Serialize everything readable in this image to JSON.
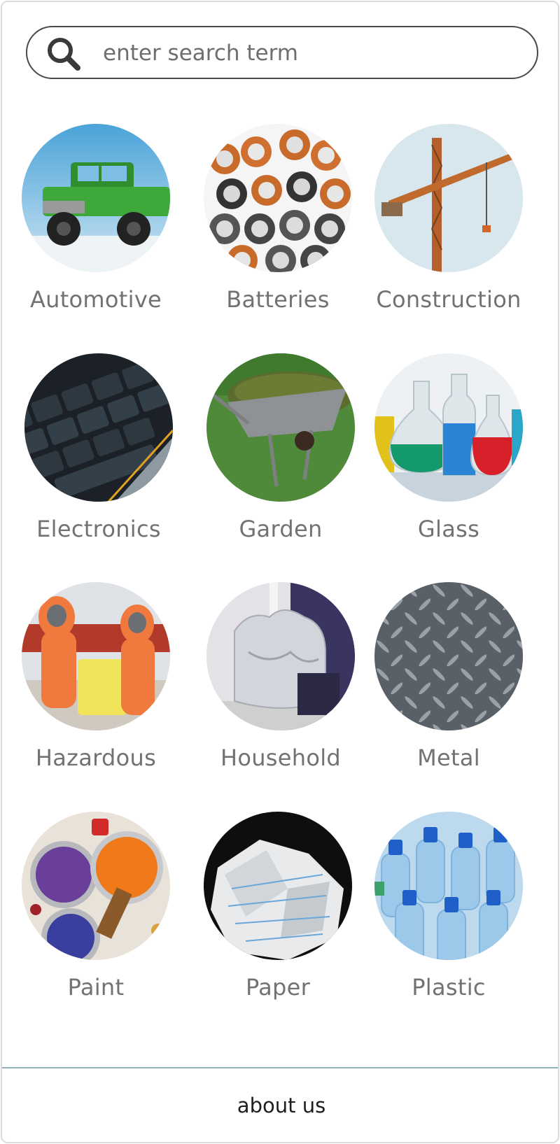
{
  "search": {
    "placeholder": "enter search term",
    "icon": "search-icon"
  },
  "categories": [
    {
      "label": "Automotive",
      "icon": "truck-image"
    },
    {
      "label": "Batteries",
      "icon": "batteries-image"
    },
    {
      "label": "Construction",
      "icon": "crane-image"
    },
    {
      "label": "Electronics",
      "icon": "keyboard-image"
    },
    {
      "label": "Garden",
      "icon": "wheelbarrow-image"
    },
    {
      "label": "Glass",
      "icon": "glass-bottles-image"
    },
    {
      "label": "Hazardous",
      "icon": "hazmat-suits-image"
    },
    {
      "label": "Household",
      "icon": "trash-bag-image"
    },
    {
      "label": "Metal",
      "icon": "metal-plate-image"
    },
    {
      "label": "Paint",
      "icon": "paint-cans-image"
    },
    {
      "label": "Paper",
      "icon": "crumpled-paper-image"
    },
    {
      "label": "Plastic",
      "icon": "plastic-bottles-image"
    }
  ],
  "footer": {
    "about_label": "about us"
  },
  "colors": {
    "divider": "#8fb3b5",
    "label_text": "#727272",
    "search_border": "#4a4a4a"
  }
}
